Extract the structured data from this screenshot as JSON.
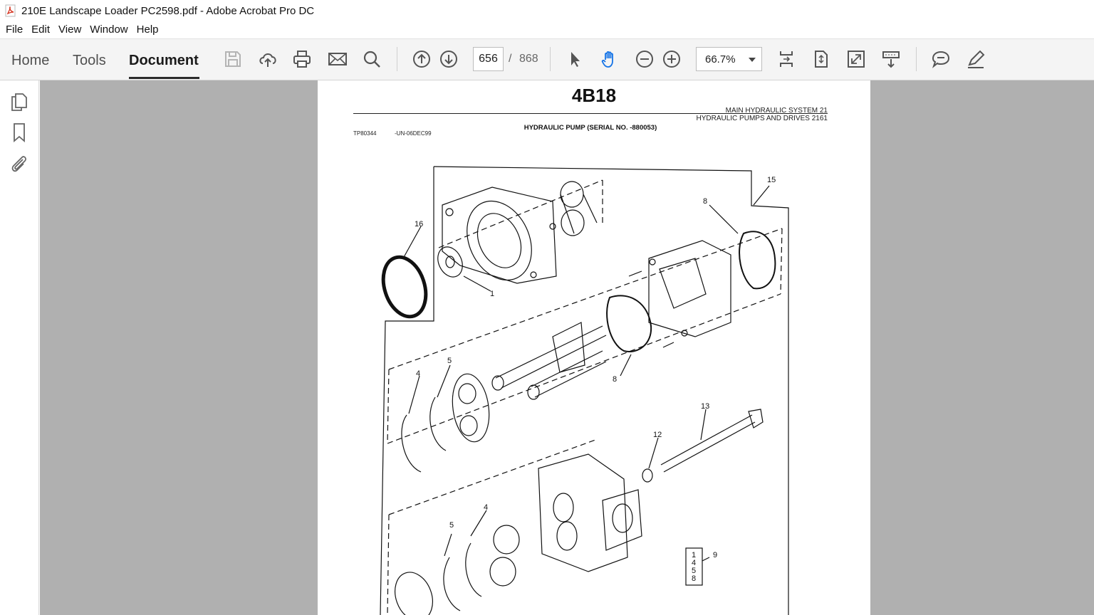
{
  "window": {
    "title": "210E Landscape Loader PC2598.pdf - Adobe Acrobat Pro DC"
  },
  "menu": [
    "File",
    "Edit",
    "View",
    "Window",
    "Help"
  ],
  "tabs": {
    "home": "Home",
    "tools": "Tools",
    "document": "Document"
  },
  "toolbar": {
    "current_page": "656",
    "page_separator": "/",
    "total_pages": "868",
    "zoom": "66.7%"
  },
  "icons": {
    "toolbar": [
      "save-icon",
      "cloud-upload-icon",
      "print-icon",
      "email-icon",
      "search-icon",
      "page-up-icon",
      "page-down-icon",
      "select-cursor-icon",
      "hand-tool-icon",
      "zoom-out-icon",
      "zoom-in-icon",
      "fit-page-icon",
      "scroll-mode-icon",
      "full-screen-icon",
      "read-mode-icon",
      "comment-icon",
      "sign-icon"
    ],
    "left_rail": [
      "pages-icon",
      "bookmark-icon",
      "attachment-icon"
    ]
  },
  "colors": {
    "toolbar_bg": "#f4f4f4",
    "doc_bg": "#b0b0b0",
    "accent_blue": "#1473e6",
    "page_bg": "#ffffff"
  },
  "document_page": {
    "code": "4B18",
    "header_line1": "MAIN HYDRAULIC SYSTEM    21",
    "header_line2": "HYDRAULIC PUMPS AND DRIVES  2161",
    "subtitle": "HYDRAULIC PUMP (SERIAL NO.  -880053)",
    "ref_left": "TP80344",
    "ref_right": "-UN-06DEC99",
    "callouts": [
      "16",
      "1",
      "15",
      "8",
      "8",
      "4",
      "5",
      "13",
      "12",
      "4",
      "5",
      "9"
    ],
    "legend_box": [
      "1",
      "4",
      "5",
      "8"
    ]
  }
}
